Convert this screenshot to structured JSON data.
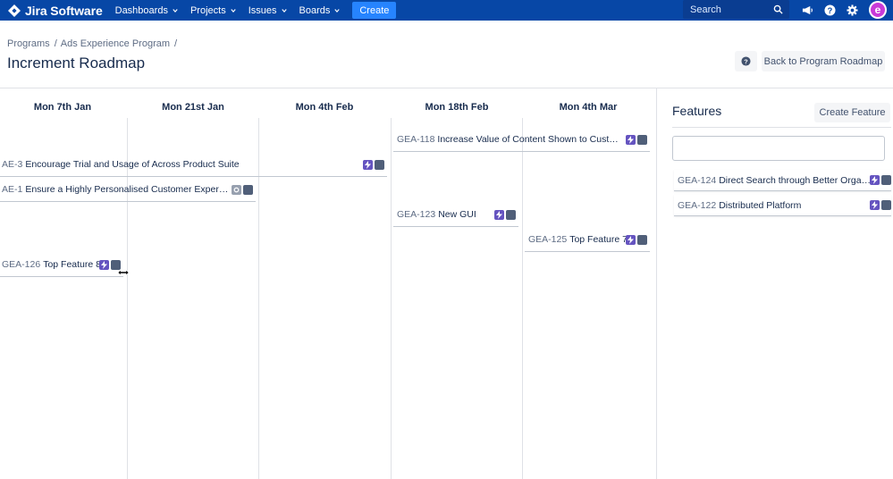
{
  "nav": {
    "logo_text": "Jira Software",
    "items": [
      "Dashboards",
      "Projects",
      "Issues",
      "Boards"
    ],
    "create_label": "Create",
    "search_placeholder": "Search",
    "avatar_letter": "e",
    "colors": {
      "bar": "#0747a6",
      "create": "#2684ff",
      "avatar": "#c83ad8"
    }
  },
  "breadcrumb": {
    "items": [
      "Programs",
      "Ads Experience Program"
    ],
    "separator": "/"
  },
  "page_title": "Increment Roadmap",
  "buttons": {
    "help": "?",
    "back": "Back to Program Roadmap"
  },
  "timeline": {
    "columns": [
      "Mon 7th Jan",
      "Mon 21st Jan",
      "Mon 4th Feb",
      "Mon 18th Feb",
      "Mon 4th Mar"
    ],
    "bars": [
      {
        "key": "GEA-118",
        "title": "Increase Value of Content Shown to Custom...",
        "icons": [
          "epic-lightning-icon",
          "status-square-icon"
        ]
      },
      {
        "key": "AE-3",
        "title": "Encourage Trial and Usage of Across Product Suite",
        "icons": [
          "epic-lightning-icon",
          "status-square-icon"
        ]
      },
      {
        "key": "AE-1",
        "title": "Ensure a Highly Personalised Customer Experien...",
        "icons": [
          "settings-icon",
          "status-square-icon"
        ]
      },
      {
        "key": "GEA-123",
        "title": "New GUI",
        "icons": [
          "epic-lightning-icon",
          "status-square-icon"
        ]
      },
      {
        "key": "GEA-125",
        "title": "Top Feature 7",
        "icons": [
          "epic-lightning-icon",
          "status-square-icon"
        ]
      },
      {
        "key": "GEA-126",
        "title": "Top Feature 8",
        "icons": [
          "epic-lightning-icon",
          "status-square-icon"
        ]
      }
    ]
  },
  "features": {
    "title": "Features",
    "create_label": "Create Feature",
    "search_value": "",
    "items": [
      {
        "key": "GEA-124",
        "title": "Direct Search through Better Organ..."
      },
      {
        "key": "GEA-122",
        "title": "Distributed Platform"
      }
    ]
  }
}
